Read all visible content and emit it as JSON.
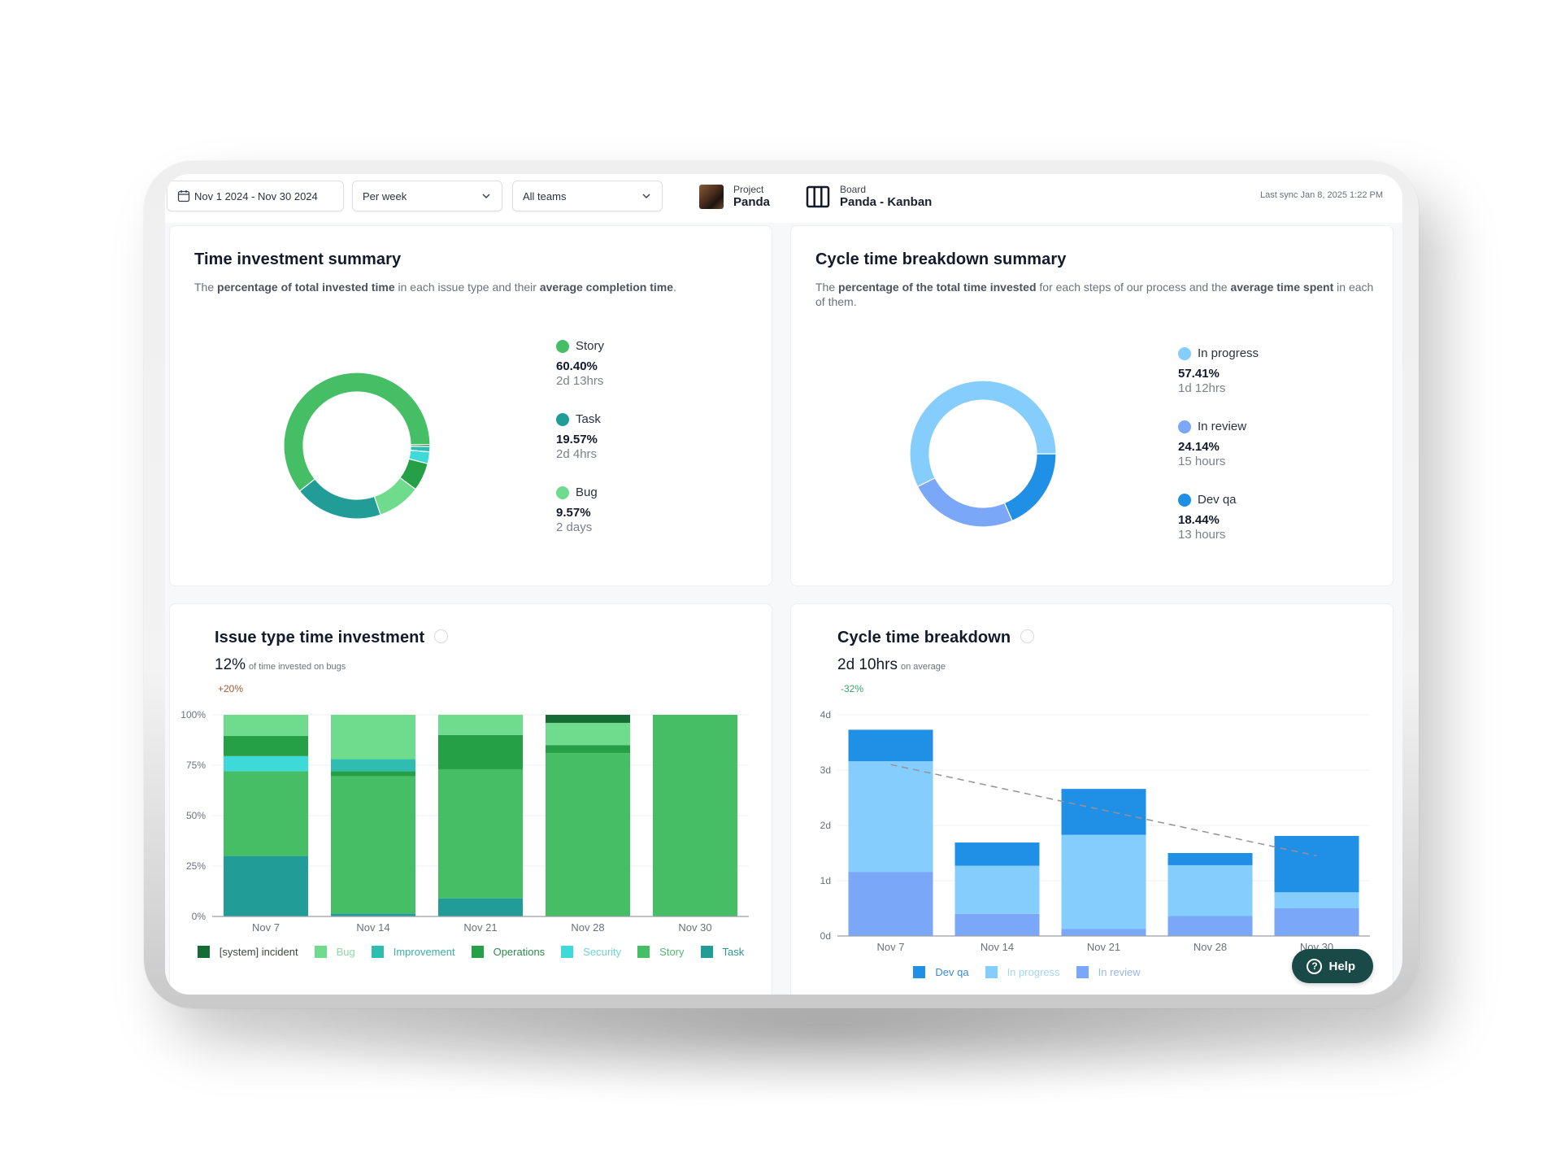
{
  "header": {
    "date_range": "Nov 1 2024 - Nov 30 2024",
    "granularity": "Per week",
    "team": "All teams",
    "project_label": "Project",
    "project_value": "Panda",
    "board_label": "Board",
    "board_value": "Panda - Kanban",
    "last_sync": "Last sync Jan 8, 2025 1:22 PM"
  },
  "time_investment_summary": {
    "title": "Time investment summary",
    "desc_parts": [
      "The ",
      "percentage of total invested time",
      " in each issue type and their ",
      "average completion time",
      "."
    ],
    "legend": [
      {
        "name": "Story",
        "pct": "60.40%",
        "time": "2d 13hrs",
        "color": "#45be65"
      },
      {
        "name": "Task",
        "pct": "19.57%",
        "time": "2d 4hrs",
        "color": "#229c97"
      },
      {
        "name": "Bug",
        "pct": "9.57%",
        "time": "2 days",
        "color": "#6fdb8d"
      }
    ]
  },
  "cycle_time_summary": {
    "title": "Cycle time breakdown summary",
    "desc_parts": [
      "The ",
      "percentage of the total time invested",
      " for each steps of our process and the ",
      "average time spent",
      " in each of them."
    ],
    "legend": [
      {
        "name": "In progress",
        "pct": "57.41%",
        "time": "1d 12hrs",
        "color": "#84cdfd"
      },
      {
        "name": "In review",
        "pct": "24.14%",
        "time": "15 hours",
        "color": "#7aa7f8"
      },
      {
        "name": "Dev qa",
        "pct": "18.44%",
        "time": "13 hours",
        "color": "#2090e6"
      }
    ]
  },
  "issue_type_investment": {
    "title": "Issue type time investment",
    "metric": "12%",
    "metric_caption": "of time invested on bugs",
    "delta": "+20%",
    "delta_color": "#a0582e"
  },
  "cycle_time_breakdown": {
    "title": "Cycle time breakdown",
    "metric": "2d 10hrs",
    "metric_caption": "on average",
    "delta": "-32%",
    "delta_color": "#3aa36a"
  },
  "help_label": "Help",
  "chart_data": [
    {
      "type": "pie",
      "title": "Time investment summary",
      "donut": true,
      "slices": [
        {
          "label": "Story",
          "value": 60.4,
          "color": "#45be65"
        },
        {
          "label": "Task",
          "value": 19.57,
          "color": "#229c97"
        },
        {
          "label": "Bug",
          "value": 9.57,
          "color": "#6fdb8d"
        },
        {
          "label": "Operations",
          "value": 6.2,
          "color": "#25a047"
        },
        {
          "label": "Security",
          "value": 2.6,
          "color": "#3ed9d9"
        },
        {
          "label": "Improvement",
          "value": 1.2,
          "color": "#2fbcb1"
        },
        {
          "label": "[system] incident",
          "value": 0.46,
          "color": "#156b34"
        }
      ]
    },
    {
      "type": "pie",
      "title": "Cycle time breakdown summary",
      "donut": true,
      "slices": [
        {
          "label": "In progress",
          "value": 57.41,
          "color": "#84cdfd"
        },
        {
          "label": "Dev qa",
          "value": 18.44,
          "color": "#2090e6"
        },
        {
          "label": "In review",
          "value": 24.14,
          "color": "#7aa7f8"
        }
      ]
    },
    {
      "type": "bar",
      "stacked": true,
      "title": "Issue type time investment",
      "categories": [
        "Nov 7",
        "Nov 14",
        "Nov 21",
        "Nov 28",
        "Nov 30"
      ],
      "yticks": [
        "0%",
        "25%",
        "50%",
        "75%",
        "100%"
      ],
      "ylim": [
        0,
        100
      ],
      "grid": true,
      "legend_position": "bottom",
      "series": [
        {
          "name": "Task",
          "color": "#229c97",
          "values": [
            30,
            1.5,
            9,
            0,
            0
          ]
        },
        {
          "name": "Story",
          "color": "#45be65",
          "values": [
            42,
            68,
            64,
            81,
            100
          ]
        },
        {
          "name": "Operations",
          "color": "#25a047",
          "values": [
            0,
            2.5,
            0,
            0,
            0
          ]
        },
        {
          "name": "Improvement",
          "color": "#2fbcb1",
          "values": [
            0,
            6,
            0,
            0,
            0
          ]
        },
        {
          "name": "Security",
          "color": "#3ed9d9",
          "values": [
            7.5,
            0,
            0,
            0,
            0
          ]
        },
        {
          "name": "Operations (top)",
          "color": "#25a047",
          "values": [
            10,
            0,
            17,
            4,
            0
          ]
        },
        {
          "name": "Bug",
          "color": "#6fdb8d",
          "values": [
            10.5,
            22,
            10,
            11,
            0
          ]
        },
        {
          "name": "[system] incident",
          "color": "#156b34",
          "values": [
            0,
            0,
            0,
            4,
            0
          ]
        }
      ],
      "legend": [
        {
          "name": "[system] incident",
          "color": "#156b34",
          "text_color": "#3a4a40"
        },
        {
          "name": "Bug",
          "color": "#6fdb8d",
          "text_color": "#8fd9a4"
        },
        {
          "name": "Improvement",
          "color": "#2fbcb1",
          "text_color": "#3ab0a7"
        },
        {
          "name": "Operations",
          "color": "#25a047",
          "text_color": "#2e8a50"
        },
        {
          "name": "Security",
          "color": "#3ed9d9",
          "text_color": "#6fd3d3"
        },
        {
          "name": "Story",
          "color": "#45be65",
          "text_color": "#55b872"
        },
        {
          "name": "Task",
          "color": "#229c97",
          "text_color": "#2b9590"
        }
      ]
    },
    {
      "type": "bar",
      "stacked": true,
      "title": "Cycle time breakdown",
      "categories": [
        "Nov 7",
        "Nov 14",
        "Nov 21",
        "Nov 28",
        "Nov 30"
      ],
      "yticks": [
        "0d",
        "1d",
        "2d",
        "3d",
        "4d"
      ],
      "ylim": [
        0,
        4
      ],
      "grid": true,
      "legend_position": "bottom",
      "series": [
        {
          "name": "In review",
          "color": "#7aa7f8",
          "values": [
            1.16,
            0.4,
            0.13,
            0.36,
            0.5
          ]
        },
        {
          "name": "In progress",
          "color": "#84cdfd",
          "values": [
            2.0,
            0.87,
            1.7,
            0.92,
            0.29
          ]
        },
        {
          "name": "Dev qa",
          "color": "#2090e6",
          "values": [
            0.57,
            0.42,
            0.83,
            0.22,
            1.02
          ]
        }
      ],
      "trend_line": {
        "start": 3.1,
        "end": 1.45,
        "style": "dashed"
      },
      "legend": [
        {
          "name": "Dev qa",
          "color": "#2090e6",
          "text_color": "#3b8ad4"
        },
        {
          "name": "In progress",
          "color": "#84cdfd",
          "text_color": "#a6d6f5"
        },
        {
          "name": "In review",
          "color": "#7aa7f8",
          "text_color": "#9bb6ea"
        }
      ]
    }
  ]
}
